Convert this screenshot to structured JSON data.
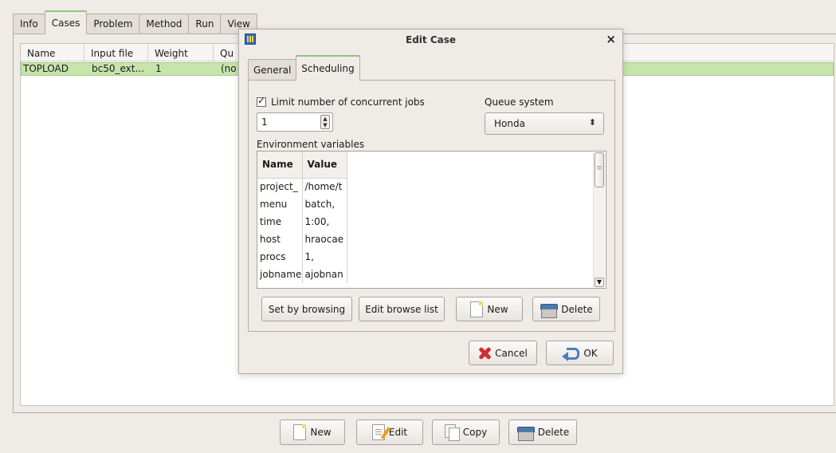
{
  "main": {
    "tabs": [
      "Info",
      "Cases",
      "Problem",
      "Method",
      "Run",
      "View"
    ],
    "active_tab": "Cases",
    "columns": [
      "Name",
      "Input file",
      "Weight",
      "Qu"
    ],
    "rows": [
      {
        "name": "TOPLOAD",
        "input_file": "bc50_ext...",
        "weight": "1",
        "queue": "(no"
      }
    ],
    "buttons": {
      "new": "New",
      "edit": "Edit",
      "copy": "Copy",
      "delete": "Delete"
    }
  },
  "dialog": {
    "title": "Edit Case",
    "close": "×",
    "tabs": [
      "General",
      "Scheduling"
    ],
    "active_tab": "Scheduling",
    "limit_jobs_label": "Limit number of concurrent jobs",
    "limit_jobs_checked": true,
    "limit_jobs_value": "1",
    "queue_label": "Queue system",
    "queue_value": "Honda",
    "env_label": "Environment variables",
    "env_columns": [
      "Name",
      "Value"
    ],
    "env_rows": [
      {
        "name": "project_",
        "value": "/home/t"
      },
      {
        "name": "menu",
        "value": "batch,"
      },
      {
        "name": "time",
        "value": "1:00,"
      },
      {
        "name": "host",
        "value": "hraocae"
      },
      {
        "name": "procs",
        "value": "1,"
      },
      {
        "name": "jobname",
        "value": "ajobnan"
      }
    ],
    "buttons": {
      "set_by_browsing": "Set by browsing",
      "edit_browse_list": "Edit browse list",
      "new": "New",
      "delete": "Delete",
      "cancel": "Cancel",
      "ok": "OK"
    }
  },
  "colors": {
    "tab_accent": "#8fc57f",
    "row_highlight": "#c8e4ad",
    "window_bg": "#efebe7"
  }
}
